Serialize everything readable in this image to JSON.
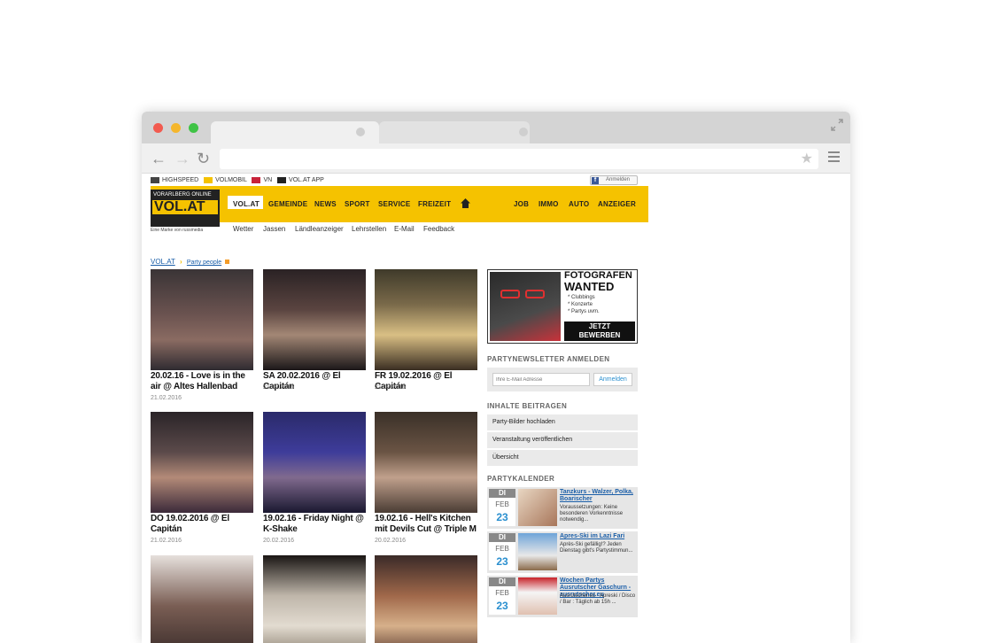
{
  "topbar": {
    "links": [
      "HIGHSPEED",
      "VOLMOBIL",
      "VN",
      "VOL.AT APP"
    ],
    "login_label": "Anmelden"
  },
  "logo": {
    "top_text": "VORARLBERG ONLINE",
    "main_text": "VOL.AT",
    "tagline": "Eine Marke von russmedia"
  },
  "nav": {
    "items": [
      "VOL.AT",
      "GEMEINDE",
      "NEWS",
      "SPORT",
      "SERVICE",
      "FREIZEIT"
    ],
    "right_items": [
      "JOB",
      "IMMO",
      "AUTO",
      "ANZEIGER"
    ],
    "sub_items": [
      "Wetter",
      "Jassen",
      "Ländleanzeiger",
      "Lehrstellen",
      "E-Mail",
      "Feedback"
    ]
  },
  "breadcrumb": {
    "home": "VOL.AT",
    "current": "Party people"
  },
  "gallery": [
    {
      "title": "20.02.16 - Love is in the air @ Altes Hallenbad",
      "date": "21.02.2016"
    },
    {
      "title": "SA 20.02.2016 @ El Capitán",
      "date": "21.02.2016"
    },
    {
      "title": "FR 19.02.2016 @ El Capitán",
      "date": "21.02.2016"
    },
    {
      "title": "DO 19.02.2016 @ El Capitán",
      "date": "21.02.2016"
    },
    {
      "title": "19.02.16 - Friday Night @ K-Shake",
      "date": "20.02.2016"
    },
    {
      "title": "19.02.16 - Hell's Kitchen mit Devils Cut @ Triple M",
      "date": "20.02.2016"
    }
  ],
  "ad": {
    "line1": "FOTOGRAFEN",
    "line2": "WANTED",
    "bullets": [
      "* Clubbings",
      "* Konzerte",
      "* Partys uvm."
    ],
    "cta1": "JETZT",
    "cta2": "BEWERBEN"
  },
  "newsletter": {
    "heading": "PARTYNEWSLETTER ANMELDEN",
    "placeholder": "Ihre E-Mail Adresse",
    "button": "Anmelden"
  },
  "contribute": {
    "heading": "INHALTE BEITRAGEN",
    "items": [
      "Party-Bilder hochladen",
      "Veranstaltung veröffentlichen",
      "Übersicht"
    ]
  },
  "calendar": {
    "heading": "PARTYKALENDER",
    "events": [
      {
        "day": "DI",
        "month": "FEB",
        "num": "23",
        "title": "Tanzkurs - Walzer, Polka, Boarischer",
        "desc": "Voraussetzungen: Keine besonderen Vorkenntnisse notwendig..."
      },
      {
        "day": "DI",
        "month": "FEB",
        "num": "23",
        "title": "Apres-Ski im Lazi Fari",
        "desc": "Après-Ski gefällig!? Jeden Dienstag gibt's Partystimmun..."
      },
      {
        "day": "DI",
        "month": "FEB",
        "num": "23",
        "title": "Wochen Partys Ausrutscher Gaschurn - ausrutscher.eu",
        "desc": "Ausrutscher.eu - Apreski / Disco / Bar : Täglich ab 15h ..."
      }
    ]
  },
  "colors": {
    "accent": "#f5c200",
    "link": "#1a5ea8",
    "date_blue": "#2a8fcf"
  }
}
